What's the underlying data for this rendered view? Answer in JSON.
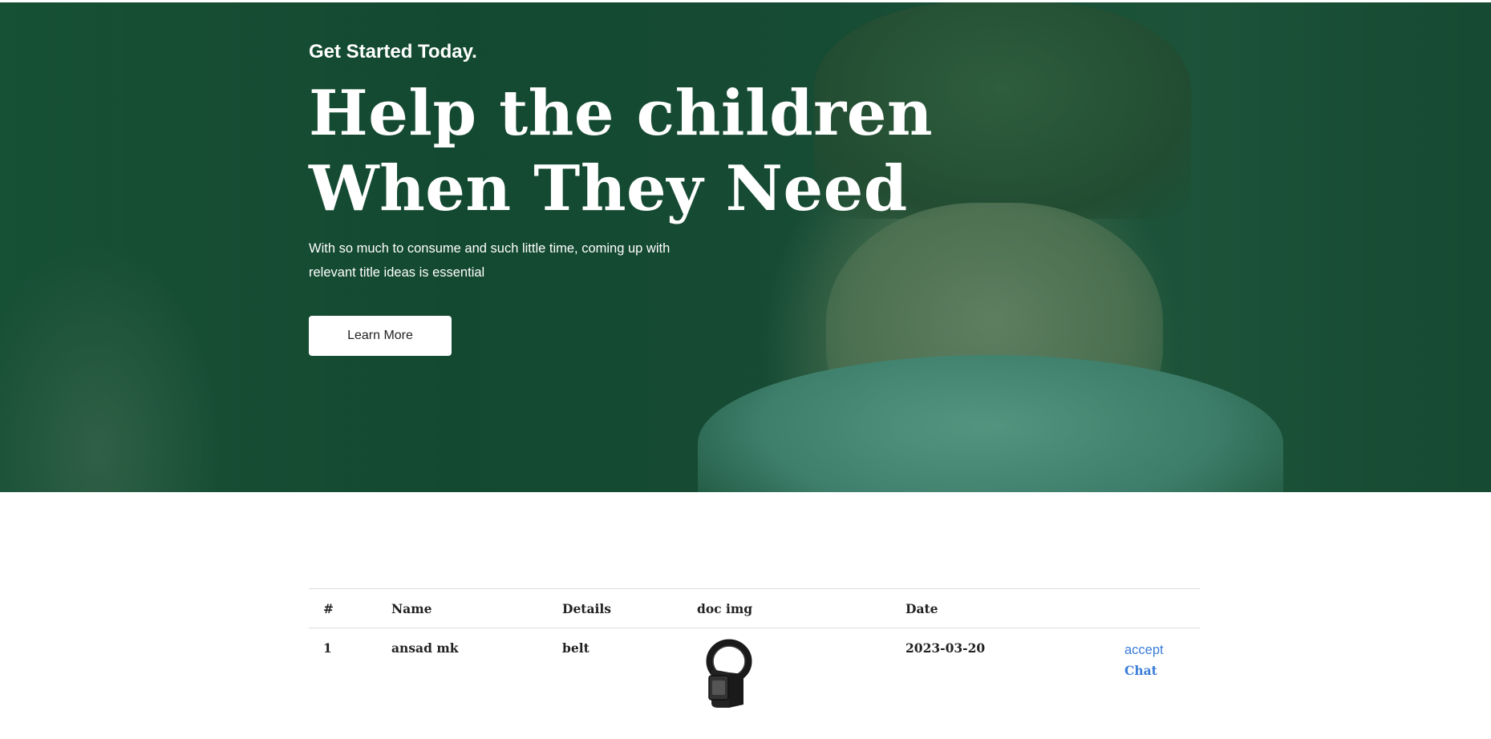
{
  "hero": {
    "eyebrow": "Get Started Today.",
    "headline_line1": "Help the children",
    "headline_line2": "When They Need",
    "subtext": "With so much to consume and such little time, coming up with relevant title ideas is essential",
    "cta_label": "Learn More"
  },
  "table": {
    "columns": [
      "#",
      "Name",
      "Details",
      "doc img",
      "Date",
      ""
    ],
    "rows": [
      {
        "num": "1",
        "name": "ansad mk",
        "details": "belt",
        "doc_img": "belt-image",
        "date": "2023-03-20",
        "accept_label": "accept",
        "chat_label": "Chat"
      }
    ]
  },
  "colors": {
    "hero_green": "#1b4d36",
    "link_blue": "#3a7dd8",
    "text": "#222222"
  }
}
